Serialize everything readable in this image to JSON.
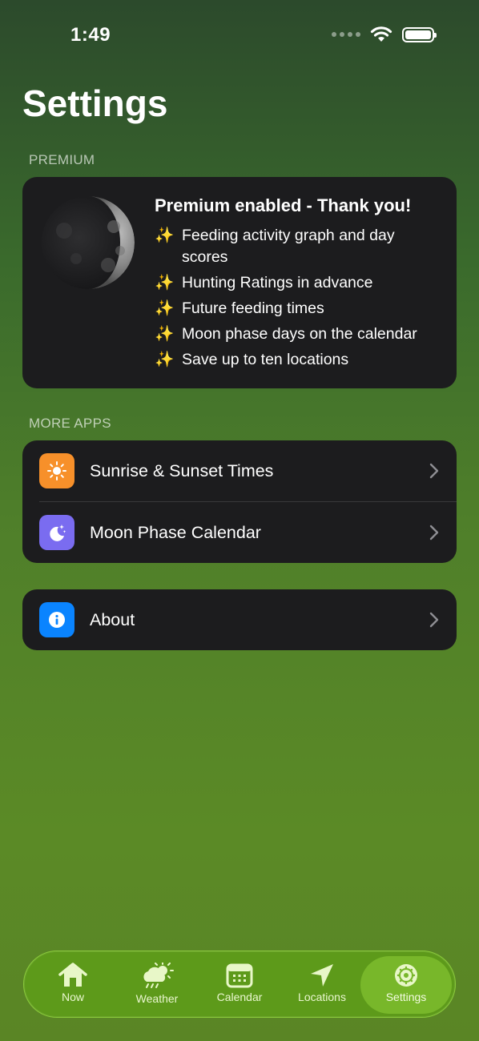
{
  "status_bar": {
    "time": "1:49"
  },
  "page_title": "Settings",
  "premium": {
    "section_header": "PREMIUM",
    "title": "Premium enabled - Thank you!",
    "features": [
      "Feeding activity graph and day scores",
      "Hunting Ratings in advance",
      "Future feeding times",
      "Moon phase days on the calendar",
      "Save up to ten locations"
    ],
    "feature_icon": "✨"
  },
  "more_apps": {
    "section_header": "MORE APPS",
    "items": [
      {
        "label": "Sunrise & Sunset Times",
        "icon": "sun-icon",
        "color": "#f7902a"
      },
      {
        "label": "Moon Phase Calendar",
        "icon": "moon-stars-icon",
        "color": "#7a6cf0"
      }
    ]
  },
  "about": {
    "label": "About",
    "icon": "info-icon",
    "color": "#0a84ff"
  },
  "tabs": [
    {
      "label": "Now",
      "icon": "house-icon"
    },
    {
      "label": "Weather",
      "icon": "cloud-sun-rain-icon"
    },
    {
      "label": "Calendar",
      "icon": "calendar-icon"
    },
    {
      "label": "Locations",
      "icon": "location-arrow-icon"
    },
    {
      "label": "Settings",
      "icon": "gear-icon",
      "active": true
    }
  ]
}
